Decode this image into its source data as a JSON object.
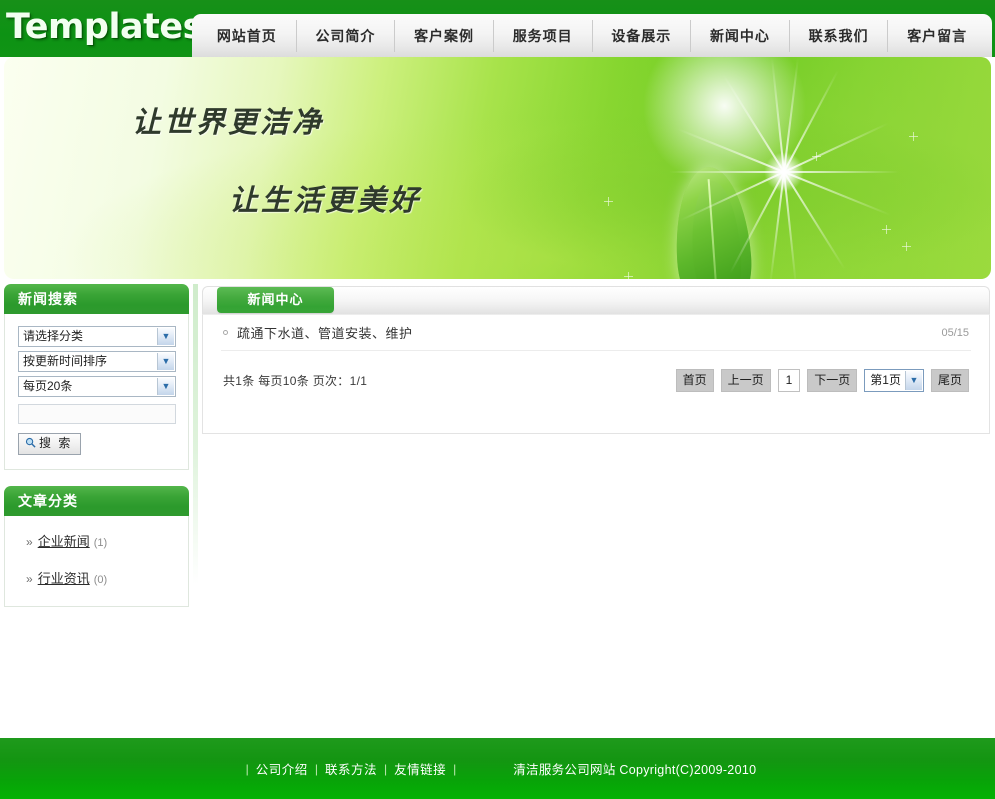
{
  "header": {
    "logo": "Templates",
    "nav": [
      {
        "label": "网站首页"
      },
      {
        "label": "公司简介"
      },
      {
        "label": "客户案例"
      },
      {
        "label": "服务项目"
      },
      {
        "label": "设备展示"
      },
      {
        "label": "新闻中心"
      },
      {
        "label": "联系我们"
      },
      {
        "label": "客户留言"
      }
    ]
  },
  "banner": {
    "slogan1": "让世界更洁净",
    "slogan2": "让生活更美好"
  },
  "sidebar": {
    "search_panel": {
      "title": "新闻搜索",
      "category_select": "请选择分类",
      "sort_select": "按更新时间排序",
      "perpage_select": "每页20条",
      "keyword_value": "",
      "keyword_placeholder": "",
      "search_button": "搜 索"
    },
    "category_panel": {
      "title": "文章分类",
      "items": [
        {
          "chevron": "»",
          "name": "企业新闻",
          "count": "(1)"
        },
        {
          "chevron": "»",
          "name": "行业资讯",
          "count": "(0)"
        }
      ]
    }
  },
  "main": {
    "tab_label": "新闻中心",
    "news": [
      {
        "title": "疏通下水道、管道安装、维护",
        "date": "05/15"
      }
    ],
    "pager": {
      "info": "共1条 每页10条 页次：1/1",
      "first": "首页",
      "prev": "上一页",
      "current": "1",
      "next": "下一页",
      "jump": "第1页",
      "last": "尾页"
    }
  },
  "footer": {
    "links": [
      {
        "label": "公司介绍"
      },
      {
        "label": "联系方法"
      },
      {
        "label": "友情链接"
      }
    ],
    "separator": "|",
    "copyright": "清洁服务公司网站 Copyright(C)2009-2010"
  },
  "colors": {
    "header_green": "#14901a",
    "panel_green": "#35a334",
    "footer_green": "#08a308",
    "banner_light": "#fbfff0",
    "banner_green": "#86d62f"
  }
}
